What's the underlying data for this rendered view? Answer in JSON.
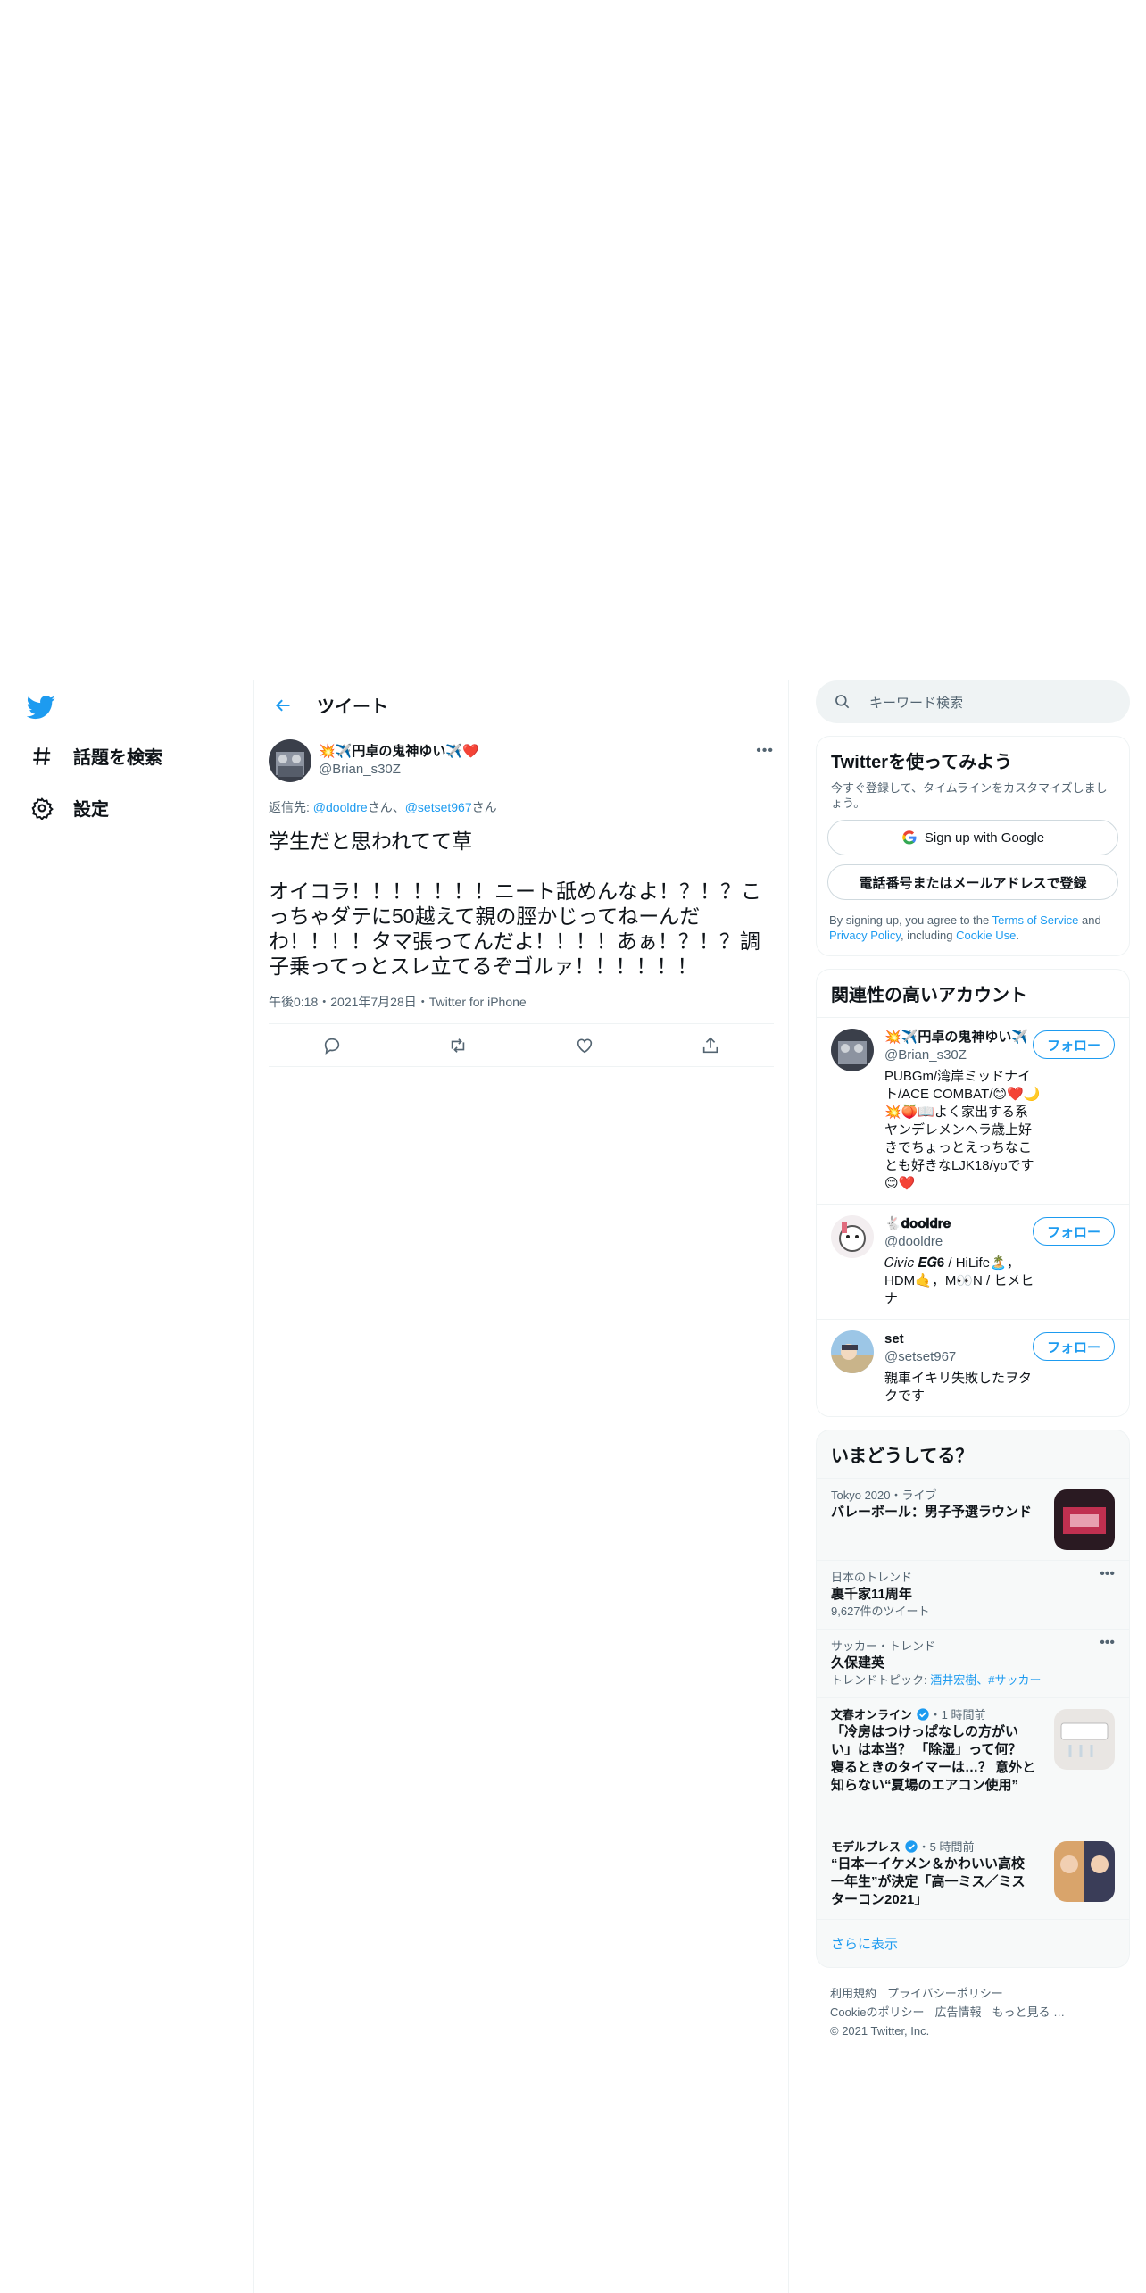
{
  "nav": {
    "search_topics": "話題を検索",
    "settings": "設定"
  },
  "header": {
    "title": "ツイート"
  },
  "tweet": {
    "author_name": "💥✈️円卓の鬼神ゆい✈️❤️",
    "author_handle": "@Brian_s30Z",
    "reply_prefix": "返信先: ",
    "reply_user1": "@dooldre",
    "reply_san1": "さん、",
    "reply_user2": "@setset967",
    "reply_san2": "さん",
    "body": "学生だと思われてて草\n\nオイコラ！！！！！！！ニート舐めんなよ！？！？こっちゃダテに50越えて親の脛かじってねーんだわ！！！！タマ張ってんだよ！！！！あぁ！？！？調子乗ってっとスレ立てるぞゴルァ！！！！！！",
    "timestamp": "午後0:18・2021年7月28日・Twitter for iPhone"
  },
  "search": {
    "placeholder": "キーワード検索"
  },
  "signup": {
    "title": "Twitterを使ってみよう",
    "subtitle": "今すぐ登録して、タイムラインをカスタマイズしましょう。",
    "google_button": "Sign up with Google",
    "phone_button": "電話番号またはメールアドレスで登録",
    "legal_1": "By signing up, you agree to the ",
    "terms": "Terms of Service",
    "legal_2": " and ",
    "privacy": "Privacy Policy",
    "legal_3": ", including ",
    "cookie": "Cookie Use",
    "legal_4": "."
  },
  "related": {
    "title": "関連性の高いアカウント",
    "follow_label": "フォロー",
    "accounts": [
      {
        "name": "💥✈️円卓の鬼神ゆい✈️",
        "handle": "@Brian_s30Z",
        "bio": "PUBGm/湾岸ミッドナイト/ACE COMBAT/😊❤️🌙💥🍑📖よく家出する系ヤンデレメンヘラ歳上好きでちょっとえっちなことも好きなLJK18/yoです😊❤️"
      },
      {
        "name": "🐇𝐝𝐨𝐨𝐥𝐝𝐫𝐞",
        "handle": "@dooldre",
        "bio": "𝐶𝑖𝑣𝑖𝑐 𝑬𝑮𝟔 / HiLife🏝️，HDM🤙，M👀N / ヒメヒナ"
      },
      {
        "name": "set",
        "handle": "@setset967",
        "bio": "親車イキリ失敗したヲタクです"
      }
    ]
  },
  "trends": {
    "title": "いまどうしてる？",
    "items": [
      {
        "context": "Tokyo 2020・ライブ",
        "title": "バレーボール：男子予選ラウンド"
      },
      {
        "context": "日本のトレンド",
        "title": "裏千家11周年",
        "count": "9,627件のツイート"
      },
      {
        "context": "サッカー・トレンド",
        "title": "久保建英",
        "topics_prefix": "トレンドトピック: ",
        "topics": "酒井宏樹、#サッカー"
      }
    ],
    "news": [
      {
        "source": "文春オンライン",
        "time": "・1 時間前",
        "title": "「冷房はつけっぱなしの方がいい」は本当？ 「除湿」って何？ 寝るときのタイマーは…？ 意外と知らない“夏場のエアコン使用”"
      },
      {
        "source": "モデルプレス",
        "time": "・5 時間前",
        "title": "“日本一イケメン＆かわいい高校一年生”が決定「高一ミス／ミスターコン2021」"
      }
    ],
    "show_more": "さらに表示"
  },
  "footer": {
    "terms": "利用規約",
    "privacy": "プライバシーポリシー",
    "cookie": "Cookieのポリシー",
    "ads": "広告情報",
    "more": "もっと見る …",
    "copyright": "© 2021 Twitter, Inc."
  }
}
